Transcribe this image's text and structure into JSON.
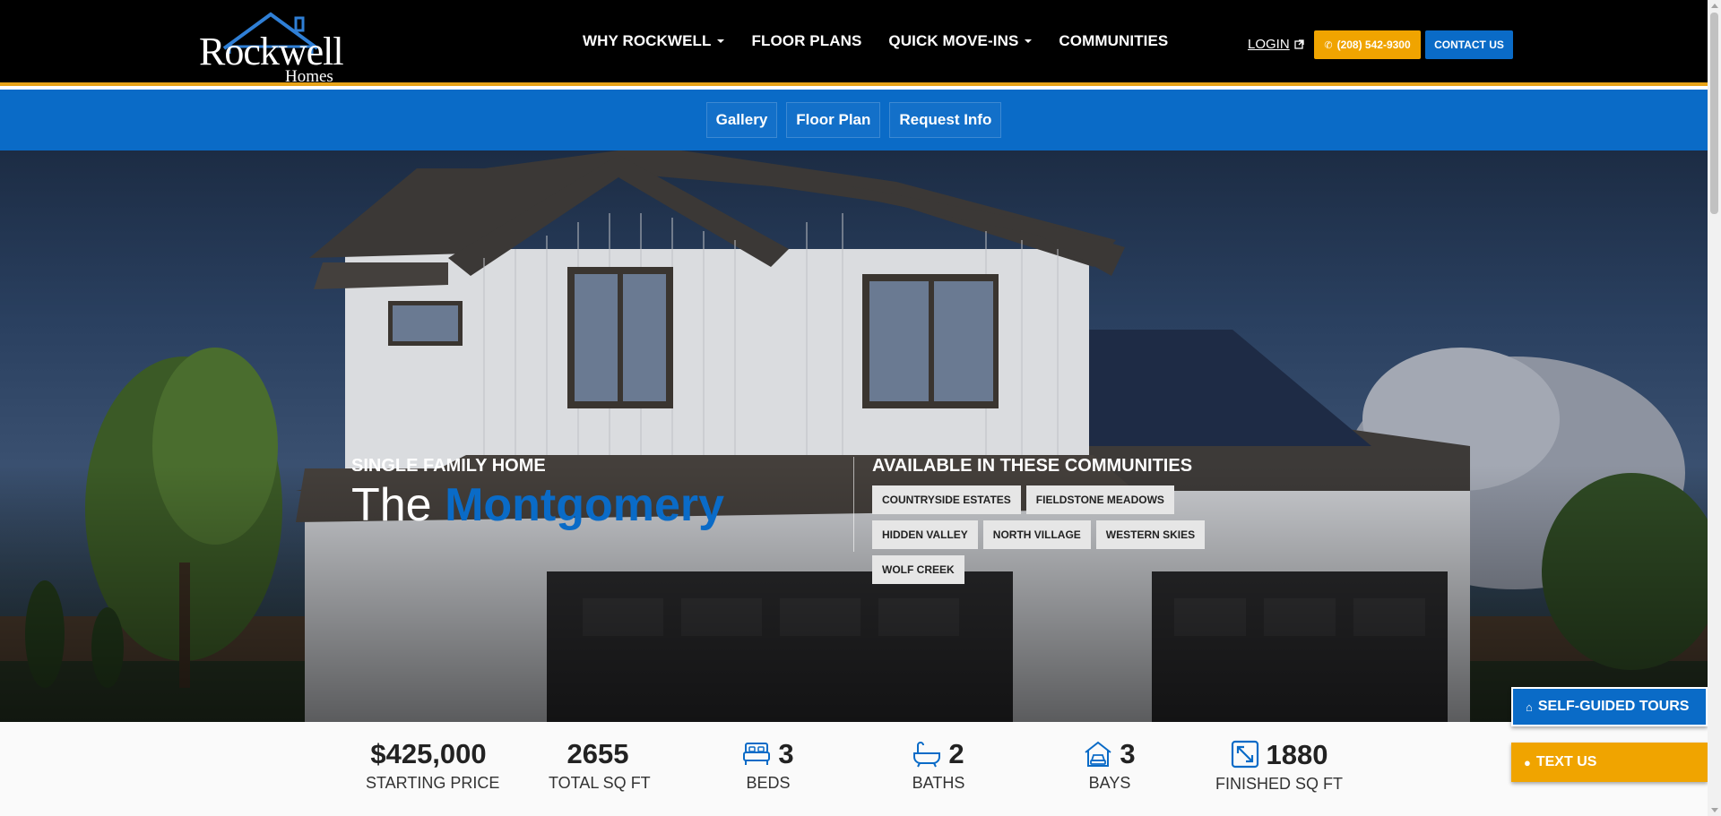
{
  "brand": {
    "logo_word": "Rockwell",
    "logo_sub": "Homes",
    "accent_blue": "#0a6bc7",
    "accent_orange": "#f0a400"
  },
  "nav": {
    "items": [
      {
        "label": "WHY ROCKWELL",
        "has_dropdown": true
      },
      {
        "label": "FLOOR PLANS",
        "has_dropdown": false
      },
      {
        "label": "QUICK MOVE-INS",
        "has_dropdown": true
      },
      {
        "label": "COMMUNITIES",
        "has_dropdown": false
      }
    ],
    "login": "LOGIN",
    "phone": "(208) 542-9300",
    "contact": "CONTACT US"
  },
  "subnav": {
    "items": [
      "Gallery",
      "Floor Plan",
      "Request Info"
    ]
  },
  "hero": {
    "kicker": "SINGLE FAMILY HOME",
    "title_prefix": "The",
    "title_name": "Montgomery",
    "communities_title": "AVAILABLE IN THESE COMMUNITIES",
    "communities": [
      "COUNTRYSIDE ESTATES",
      "FIELDSTONE MEADOWS",
      "HIDDEN VALLEY",
      "NORTH VILLAGE",
      "WESTERN SKIES",
      "WOLF CREEK"
    ]
  },
  "stats": {
    "price": {
      "value": "$425,000",
      "label": "STARTING PRICE"
    },
    "total_sqft": {
      "value": "2655",
      "label": "TOTAL SQ FT"
    },
    "beds": {
      "value": "3",
      "label": "BEDS",
      "icon": "bed-icon"
    },
    "baths": {
      "value": "2",
      "label": "BATHS",
      "icon": "bathtub-icon"
    },
    "bays": {
      "value": "3",
      "label": "BAYS",
      "icon": "garage-icon"
    },
    "finished_sqft": {
      "value": "1880",
      "label": "FINISHED SQ FT",
      "icon": "expand-icon"
    }
  },
  "floating": {
    "tours": "SELF-GUIDED TOURS",
    "text_us": "TEXT US"
  }
}
